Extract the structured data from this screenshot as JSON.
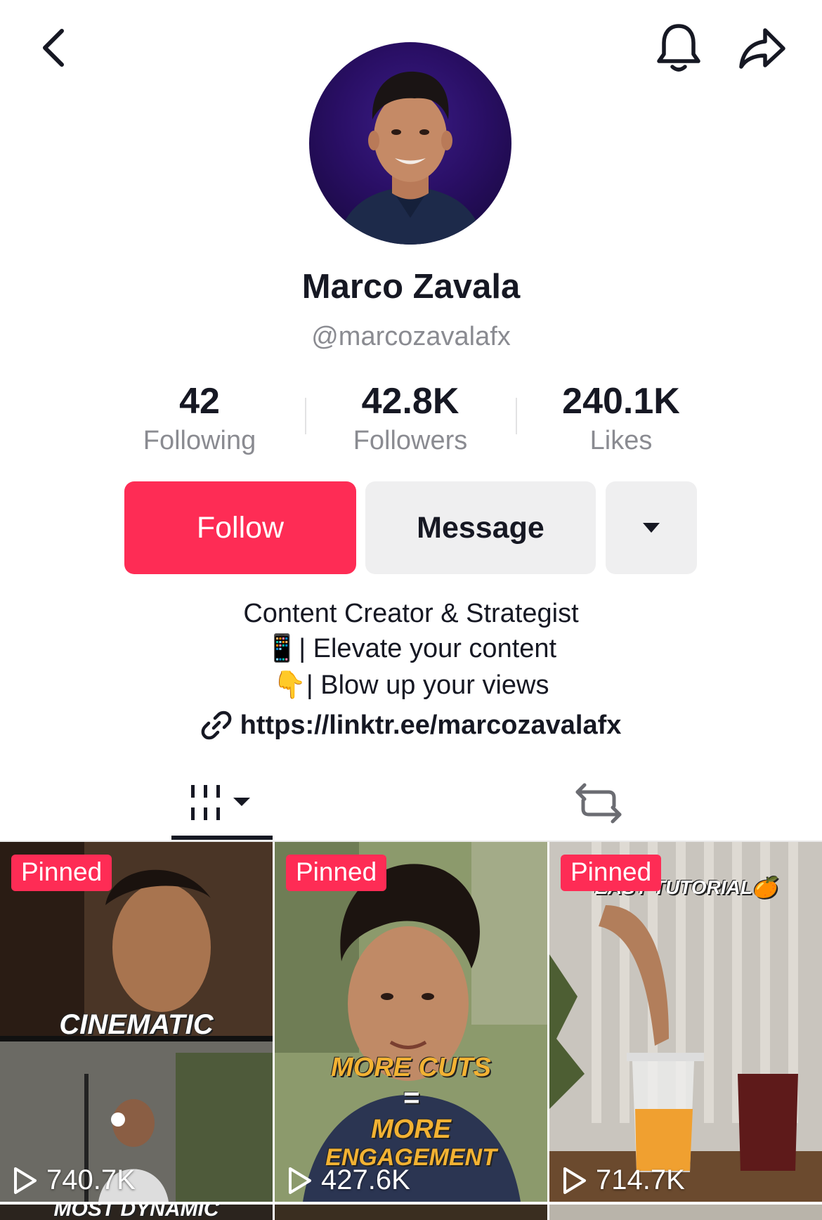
{
  "header": {
    "back_icon": "chevron-left-icon",
    "bell_icon": "bell-icon",
    "share_icon": "share-arrow-icon"
  },
  "profile": {
    "name": "Marco Zavala",
    "handle": "@marcozavalafx",
    "stats": [
      {
        "value": "42",
        "label": "Following"
      },
      {
        "value": "42.8K",
        "label": "Followers"
      },
      {
        "value": "240.1K",
        "label": "Likes"
      }
    ]
  },
  "actions": {
    "follow_label": "Follow",
    "message_label": "Message",
    "more_icon": "caret-down-icon"
  },
  "bio": {
    "line1": "Content Creator & Strategist",
    "line2_emoji": "📱",
    "line2": "| Elevate your content",
    "line3_emoji": "👇",
    "line3": "| Blow up your views",
    "link": "https://linktr.ee/marcozavalafx"
  },
  "tabs": {
    "videos_icon": "grid-bars-icon",
    "reposts_icon": "repost-icon"
  },
  "videos": [
    {
      "pinned": "Pinned",
      "views": "740.7K",
      "caption_top": "CINEMATIC",
      "caption_bottom": "MOST DYNAMIC"
    },
    {
      "pinned": "Pinned",
      "views": "427.6K",
      "caption_top": "MORE CUTS",
      "caption_mid": "=",
      "caption_line2": "MORE",
      "caption_line3": "ENGAGEMENT"
    },
    {
      "pinned": "Pinned",
      "views": "714.7K",
      "caption_top": "EASY TUTORIAL🍊"
    }
  ],
  "colors": {
    "accent": "#fe2c55",
    "text_primary": "#161823",
    "text_secondary": "#8a8b91",
    "button_grey": "#efeff0"
  }
}
